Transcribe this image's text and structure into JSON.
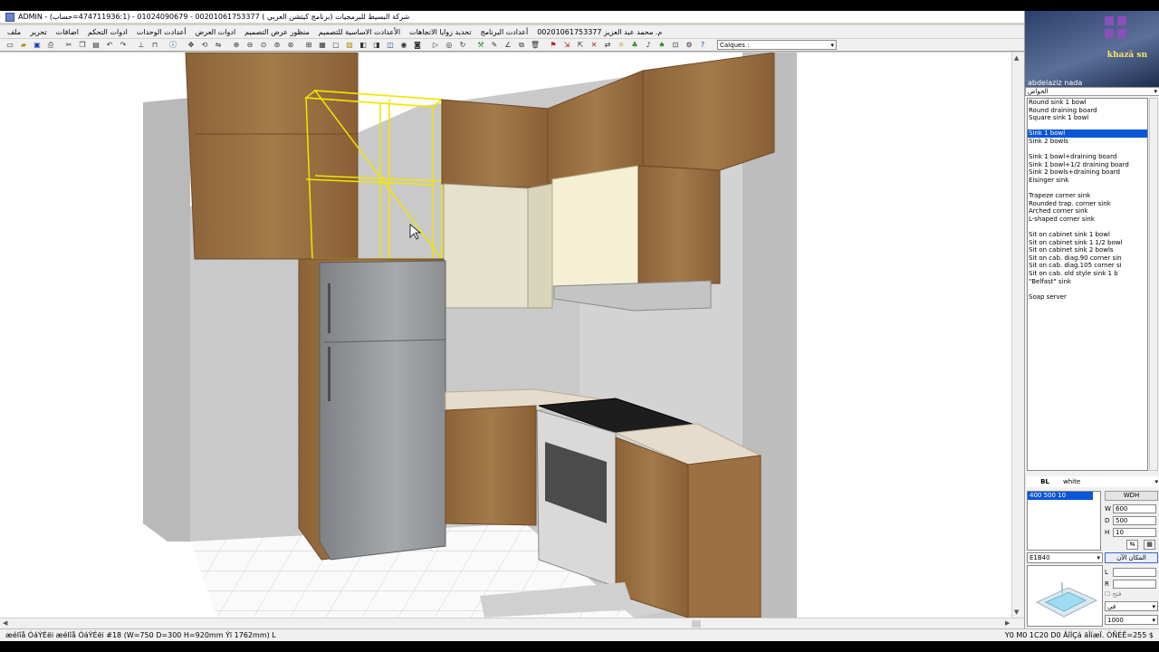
{
  "window": {
    "title": "ADMIN - شركة البسيط للبرمجيات (برنامج كيتشن العربي ) 00201061753377 - 01024090679 - (474711936:1=حساب)"
  },
  "menubar": {
    "items": [
      "ملف",
      "تحرير",
      "اضافات",
      "ادوات التحكم",
      "أعدادت الوحدات",
      "ادوات العرض",
      "منظور عرض التصميم",
      "الأعدادت الاساسية للتصميم",
      "تحديد زوايا الاتجاهات",
      "أعدادت البرنامج",
      "م. محمد عبد العزيز 00201061753377"
    ]
  },
  "toolbar": {
    "calques_label": "Calques :"
  },
  "viewport": {
    "description_hidden": ""
  },
  "statusbar": {
    "left": "æéIîå ÓáÝÉëi   æéIîå ÓáÝÉëi #18  (W=750 D=300 H=920mm Ýï 1762mm) L",
    "right": "Y0 M0  1C20 D0 ÂîÍÇá äÎíæÏ. ÒÑÉË=255 $"
  },
  "right_panel": {
    "webcam_caption": "khazä sn",
    "user_name": "abdelaziz nada",
    "tab_label": "الحواض",
    "sink_list": [
      "Round sink 1 bowl",
      "Round draining board",
      "Square sink 1 bowl",
      "",
      "Sink 1 bowl",
      "Sink 2 bowls",
      "",
      "Sink 1 bowl+draining board",
      "Sink 1 bowl+1/2 draining board",
      "Sink 2 bowls+draining board",
      "Eisinger sink",
      "",
      "Trapeze corner sink",
      "Rounded trap. corner sink",
      "Arched corner sink",
      "L-shaped corner sink",
      "",
      "Sit on cabinet sink 1 bowl",
      "Sit on cabinet sink 1 1/2 bowl",
      "Sit on cabinet sink 2 bowls",
      "Sit on cab. diag.90 corner sin",
      "Sit on cab. diag.105 corner si",
      "Sit on cab. old style sink 1 b",
      "\"Belfast\" sink",
      "",
      "Soap server"
    ],
    "selected_sink": "Sink 1 bowl",
    "material_key": "BL",
    "material_value": "white",
    "dim_list": [
      "400   500   10"
    ],
    "wdh_label": "WDH",
    "width_label": "W",
    "width_value": "600",
    "depth_label": "D",
    "depth_value": "500",
    "height_label": "H",
    "height_value": "10",
    "code_value": "E1B40",
    "apply_label": "المكان الآن",
    "l_label": "L",
    "r_label": "R",
    "check_label": "فتح",
    "side_value": "في",
    "size_value": "1000"
  }
}
